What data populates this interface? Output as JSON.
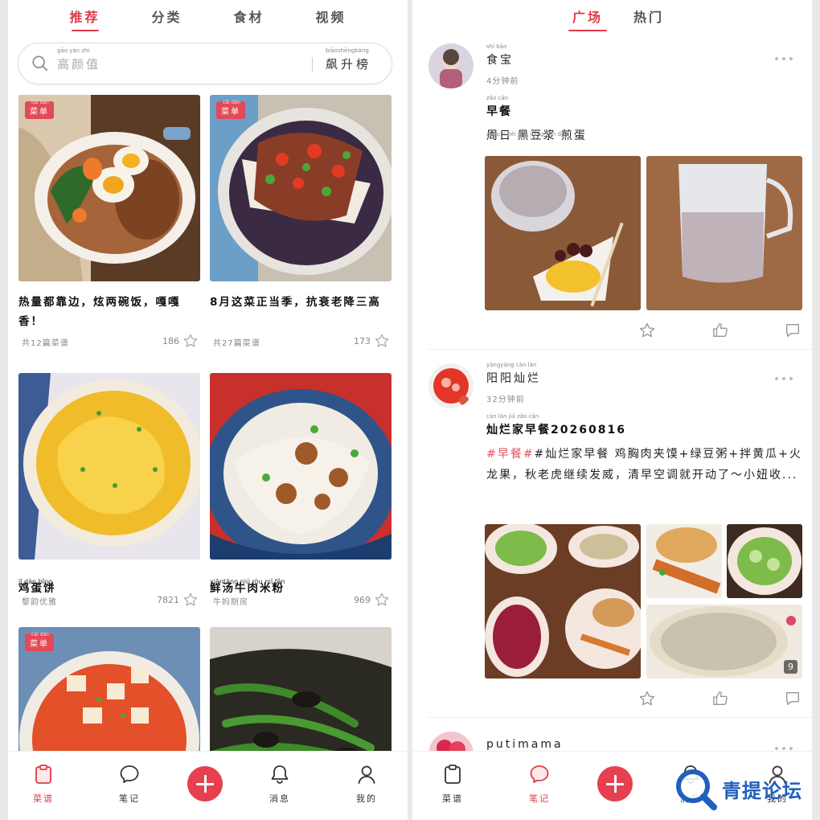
{
  "left": {
    "tabs": [
      {
        "label": "推荐",
        "active": true
      },
      {
        "label": "分类",
        "active": false
      },
      {
        "label": "食材",
        "active": false
      },
      {
        "label": "视频",
        "active": false
      }
    ],
    "search": {
      "placeholder": "高颜值",
      "placeholder_pinyin": "gāo yán zhí",
      "trending_label": "飙升榜",
      "trending_pinyin": "biāoshēngbǎng"
    },
    "recipes": [
      {
        "badge": "菜单",
        "badge_pinyin": "cài dān",
        "title": "热量都靠边，炫两碗饭，嘎嘎香！",
        "author": "共12篇菜谱",
        "count": "186"
      },
      {
        "badge": "菜单",
        "badge_pinyin": "cài dān",
        "title": "8月这菜正当季，抗衰老降三高",
        "author": "共27篇菜谱",
        "count": "173"
      },
      {
        "badge": "",
        "title": "鸡蛋饼",
        "title_pinyin": "jī dàn bǐng",
        "author": "黎韵优雅",
        "count": "7821"
      },
      {
        "badge": "",
        "title": "鲜汤牛肉米粉",
        "title_pinyin": "xiāntāng niú ròu mǐ fěn",
        "author": "牛妈厨房",
        "count": "969"
      },
      {
        "badge": "菜单",
        "badge_pinyin": "cài dān",
        "title": "",
        "author": "",
        "count": ""
      },
      {
        "badge": "",
        "title": "",
        "author": "",
        "count": ""
      }
    ],
    "nav": [
      {
        "label": "菜谱",
        "icon": "clipboard-icon",
        "active": true
      },
      {
        "label": "笔记",
        "icon": "chat-bubble-icon",
        "active": false
      },
      {
        "label": "消息",
        "icon": "bell-icon",
        "active": false
      },
      {
        "label": "我的",
        "icon": "person-icon",
        "active": false
      }
    ]
  },
  "right": {
    "tabs": [
      {
        "label": "广场",
        "active": true
      },
      {
        "label": "热门",
        "active": false
      }
    ],
    "posts": [
      {
        "user": "食宝",
        "user_pinyin": "shí bǎo",
        "time": "4分钟前",
        "title": "早餐",
        "title_pinyin": "zǎo cān",
        "body": "周日 黑豆浆 煎蛋",
        "body_pinyin": "zhōu rì   hēi dòu jiāng   jiān dàn"
      },
      {
        "user": "阳阳灿烂",
        "user_pinyin": "yángyáng càn làn",
        "time": "32分钟前",
        "title": "灿烂家早餐20260816",
        "title_pinyin": "càn làn jiā zǎo cān",
        "tag": "#早餐#",
        "body": "#灿烂家早餐 鸡胸肉夹馍+绿豆粥+拌黄瓜+火龙果，秋老虎继续发威，清早空调就开动了～小妞收...",
        "image_count": "9"
      },
      {
        "user": "putimama",
        "time": ""
      }
    ],
    "nav": [
      {
        "label": "菜谱",
        "icon": "clipboard-icon",
        "active": false
      },
      {
        "label": "笔记",
        "icon": "chat-bubble-icon",
        "active": true
      },
      {
        "label": "消息",
        "icon": "bell-icon",
        "active": false
      },
      {
        "label": "我的",
        "icon": "person-icon",
        "active": false
      }
    ]
  },
  "watermark": {
    "text": "青提论坛",
    "icon": "magnifier-logo-icon"
  },
  "colors": {
    "accent": "#e23a4a",
    "watermark": "#1f5fbf"
  }
}
